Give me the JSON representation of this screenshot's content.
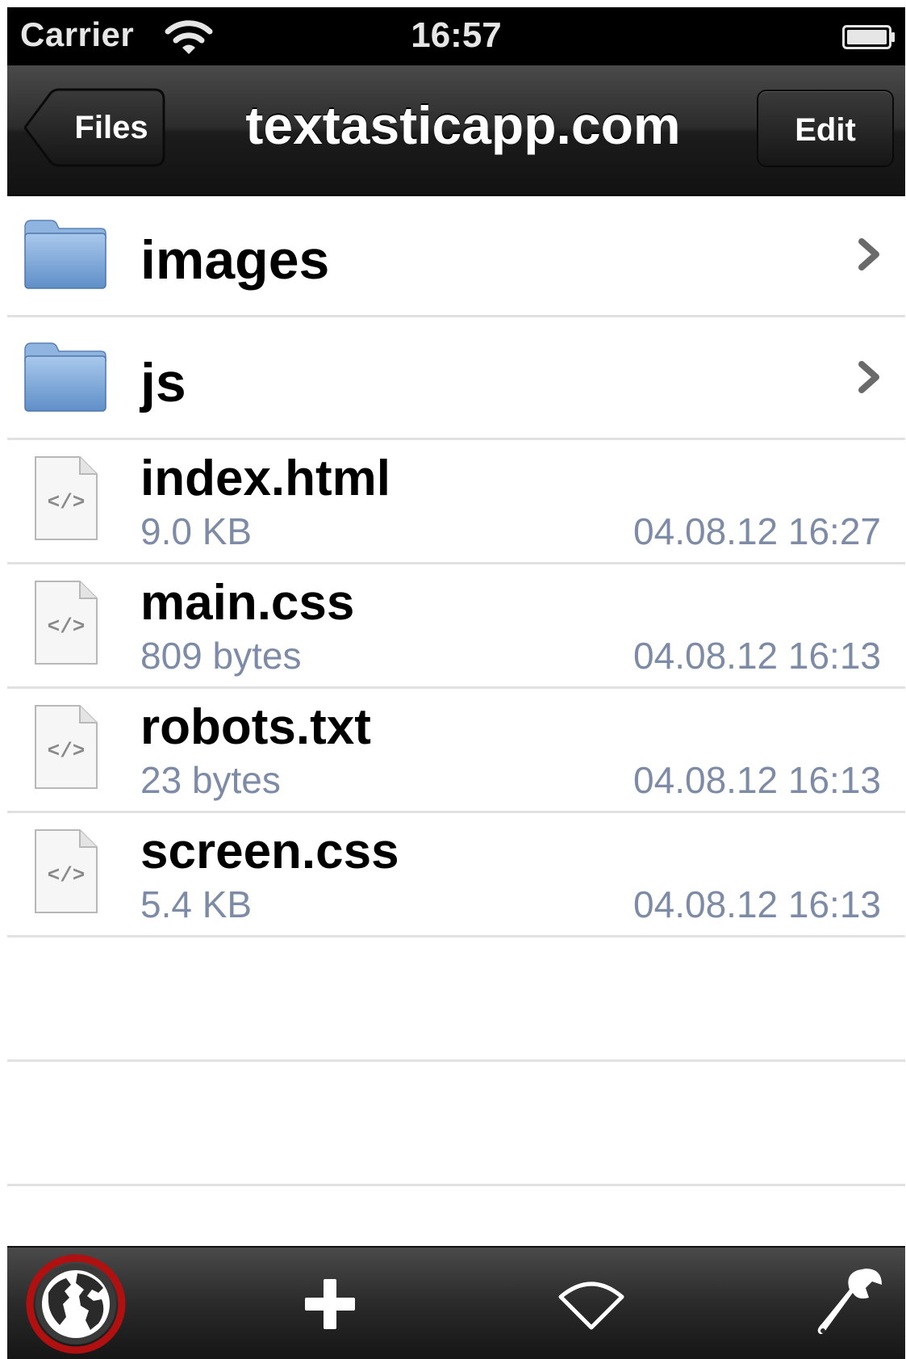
{
  "status_bar": {
    "carrier": "Carrier",
    "time": "16:57",
    "wifi_icon": "wifi-icon",
    "battery_icon": "battery-icon"
  },
  "nav": {
    "back_label": "Files",
    "title": "textasticapp.com",
    "edit_label": "Edit"
  },
  "folders": [
    {
      "name": "images",
      "icon": "folder-icon"
    },
    {
      "name": "js",
      "icon": "folder-icon"
    }
  ],
  "files": [
    {
      "name": "index.html",
      "size": "9.0 KB",
      "date": "04.08.12 16:27",
      "icon": "code-file-icon"
    },
    {
      "name": "main.css",
      "size": "809 bytes",
      "date": "04.08.12 16:13",
      "icon": "code-file-icon"
    },
    {
      "name": "robots.txt",
      "size": "23 bytes",
      "date": "04.08.12 16:13",
      "icon": "code-file-icon"
    },
    {
      "name": "screen.css",
      "size": "5.4 KB",
      "date": "04.08.12 16:13",
      "icon": "code-file-icon"
    }
  ],
  "toolbar": {
    "buttons": [
      "globe-icon",
      "plus-icon",
      "wifi-icon",
      "wrench-icon"
    ],
    "highlight_color": "#b01010"
  },
  "colors": {
    "meta_text": "#7d8ba6",
    "separator": "#e1e1e1"
  }
}
